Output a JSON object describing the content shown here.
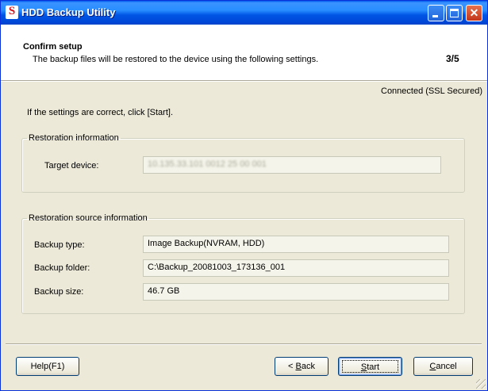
{
  "window": {
    "title": "HDD Backup Utility",
    "app_icon_glyph": "S",
    "icon": "app-logo-icon",
    "minimize_icon": "minimize-icon",
    "maximize_icon": "maximize-icon",
    "close_glyph": "✕"
  },
  "header": {
    "title": "Confirm setup",
    "subtitle": "The backup files will be restored to the device using the following settings.",
    "step": "3/5"
  },
  "status": {
    "connection": "Connected (SSL Secured)"
  },
  "instruction": "If the settings are correct, click [Start].",
  "restoration_info": {
    "legend": "Restoration information",
    "target_device_label": "Target device:",
    "target_device_value": "10.135.33.101 0012 25 00 001"
  },
  "source_info": {
    "legend": "Restoration source information",
    "backup_type_label": "Backup type:",
    "backup_type_value": "Image Backup(NVRAM, HDD)",
    "backup_folder_label": "Backup folder:",
    "backup_folder_value": "C:\\Backup_20081003_173136_001",
    "backup_size_label": "Backup size:",
    "backup_size_value": "46.7 GB"
  },
  "buttons": {
    "help": "Help(F1)",
    "back_prefix": "< ",
    "back_mnemonic": "B",
    "back_rest": "ack",
    "start_mnemonic": "S",
    "start_rest": "tart",
    "cancel_mnemonic": "C",
    "cancel_rest": "ancel"
  },
  "colors": {
    "titlebar": "#0055e5",
    "dialog_bg": "#ece9d8",
    "header_bg": "#ffffff",
    "close_button": "#c2351a"
  }
}
